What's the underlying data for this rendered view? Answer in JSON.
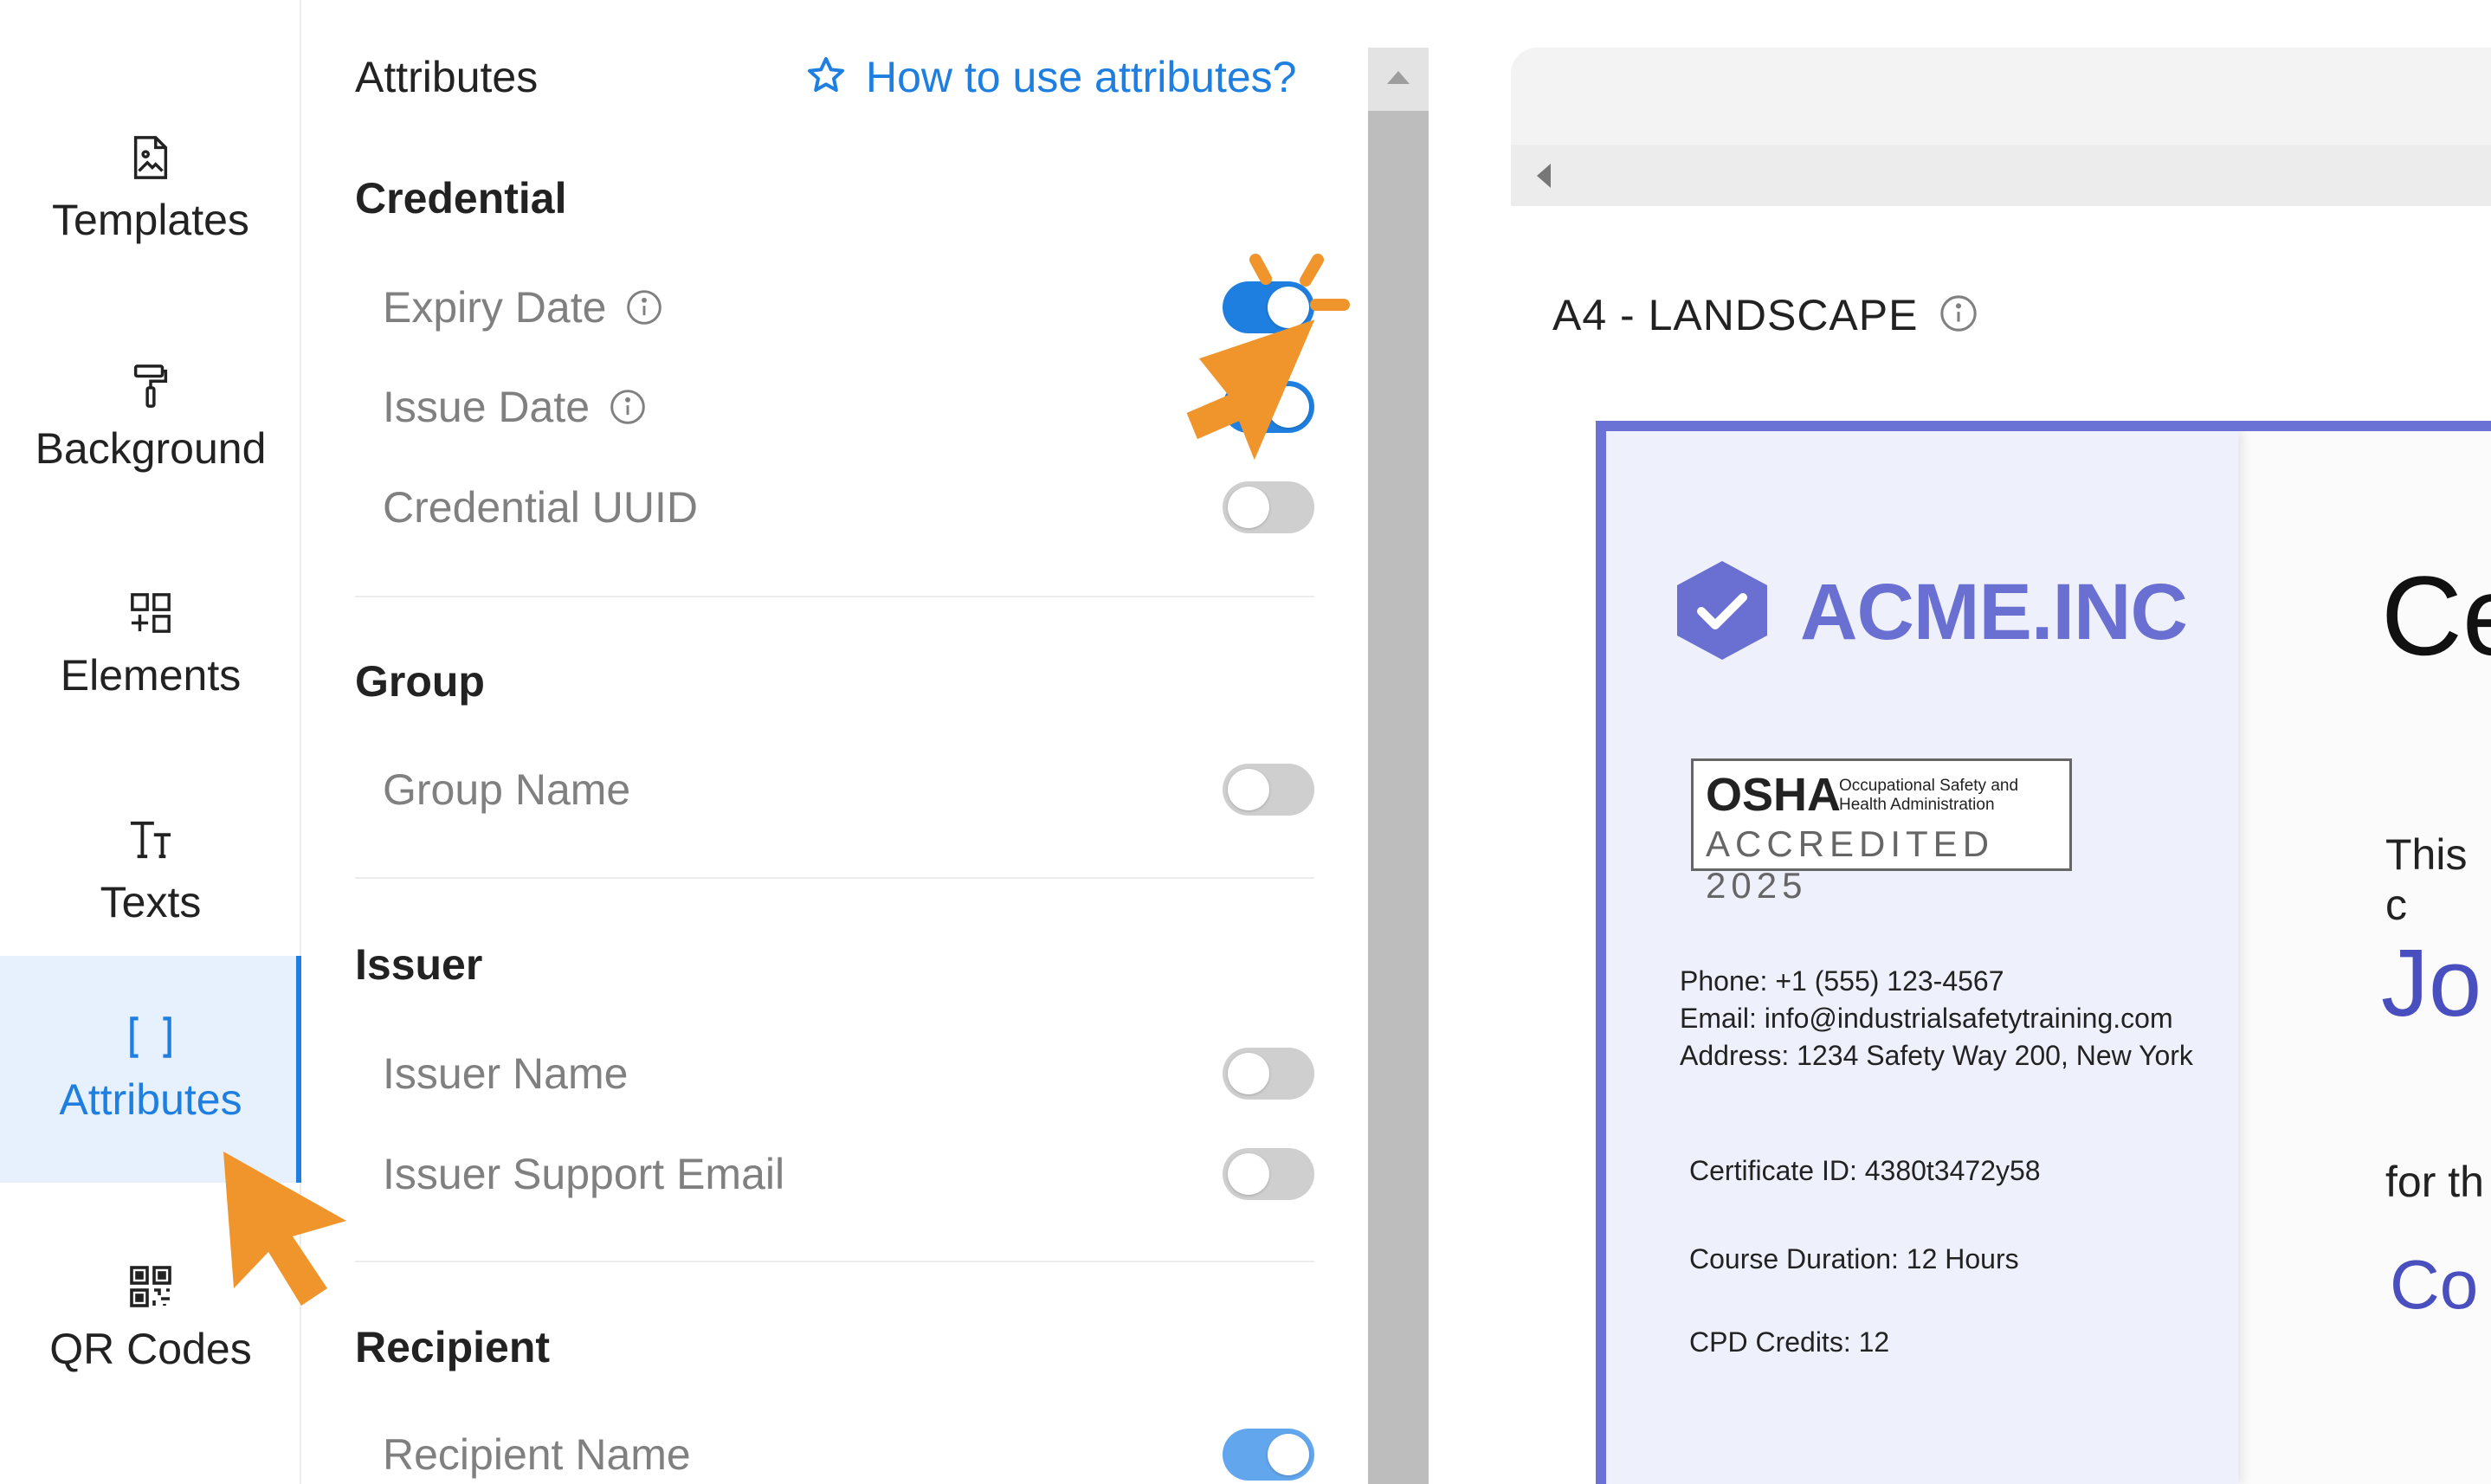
{
  "nav": {
    "items": [
      {
        "label": "Templates",
        "icon": "file-image-icon"
      },
      {
        "label": "Background",
        "icon": "paint-roller-icon"
      },
      {
        "label": "Elements",
        "icon": "elements-grid-icon"
      },
      {
        "label": "Texts",
        "icon": "text-size-icon"
      },
      {
        "label": "Attributes",
        "icon": "brackets-icon",
        "active": true
      },
      {
        "label": "QR Codes",
        "icon": "qr-code-icon"
      }
    ]
  },
  "panel": {
    "title": "Attributes",
    "help_link": "How to use attributes?",
    "sections": {
      "credential": {
        "title": "Credential",
        "rows": [
          {
            "label": "Expiry Date",
            "enabled": true
          },
          {
            "label": "Issue Date",
            "enabled": true
          },
          {
            "label": "Credential UUID",
            "enabled": false
          }
        ]
      },
      "group": {
        "title": "Group",
        "rows": [
          {
            "label": "Group Name",
            "enabled": false
          }
        ]
      },
      "issuer": {
        "title": "Issuer",
        "rows": [
          {
            "label": "Issuer Name",
            "enabled": false
          },
          {
            "label": "Issuer Support Email",
            "enabled": false
          }
        ]
      },
      "recipient": {
        "title": "Recipient",
        "rows": [
          {
            "label": "Recipient Name",
            "enabled": true
          }
        ]
      }
    }
  },
  "canvas": {
    "size_label": "A4 - LANDSCAPE"
  },
  "certificate": {
    "logo_text": "ACME.INC",
    "osha_big": "OSHA",
    "osha_small": "Occupational Safety and Health Administration",
    "osha_accredited": "ACCREDITED 2025",
    "phone": "Phone: +1 (555) 123-4567",
    "email": "Email: info@industrialsafetytraining.com",
    "address": "Address: 1234 Safety Way 200, New York",
    "certificate_id": "Certificate ID: 4380t3472y58",
    "course_duration": "Course Duration: 12 Hours",
    "cpd_credits": "CPD Credits: 12",
    "title_partial": "Ce",
    "this_partial": "This c",
    "name_partial": "Jo",
    "for_partial": "for th",
    "course_partial": "Co"
  },
  "colors": {
    "accent": "#1e7fe0",
    "active_bg": "#e6f1fd",
    "cert_border": "#6b72d6",
    "cert_text": "#4a4fc0",
    "cursor": "#f0952b"
  }
}
